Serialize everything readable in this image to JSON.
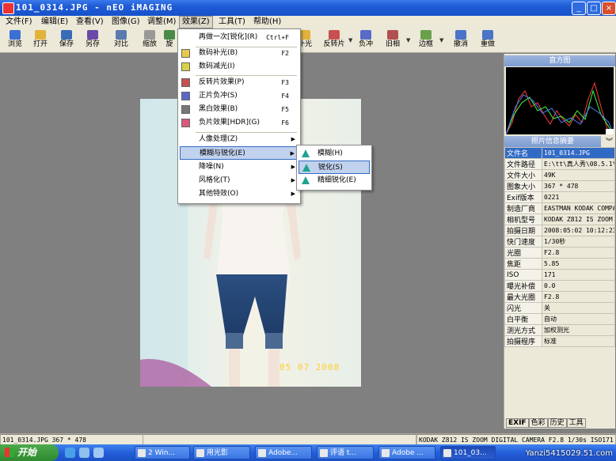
{
  "window": {
    "title": "101_0314.JPG - nEO iMAGING",
    "buttons": [
      "_",
      "□",
      "×"
    ]
  },
  "menubar": [
    {
      "label": "文件(F)"
    },
    {
      "label": "编辑(E)"
    },
    {
      "label": "查看(V)"
    },
    {
      "label": "图像(G)"
    },
    {
      "label": "调整(M)"
    },
    {
      "label": "效果(Z)"
    },
    {
      "label": "工具(T)"
    },
    {
      "label": "帮助(H)"
    }
  ],
  "toolbar": [
    {
      "label": "浏览",
      "icon": "browse-icon",
      "color": "#3b6fd4"
    },
    {
      "label": "打开",
      "icon": "open-folder-icon",
      "color": "#e2b33a"
    },
    {
      "label": "保存",
      "icon": "save-disk-icon",
      "color": "#3a6bb8"
    },
    {
      "label": "另存",
      "icon": "save-as-icon",
      "color": "#6a4aa8"
    },
    {
      "label": "对比",
      "icon": "compare-icon",
      "color": "#5a7ab0"
    },
    {
      "label": "缩放",
      "icon": "zoom-icon",
      "color": "#999999"
    },
    {
      "label": "旋",
      "icon": "rotate-icon",
      "color": "#4a8a4a"
    },
    {
      "label": "补光",
      "icon": "fill-light-icon",
      "color": "#e2b33a"
    },
    {
      "label": "反转片",
      "icon": "reversal-icon",
      "color": "#c85050"
    },
    {
      "label": "负冲",
      "icon": "cross-process-icon",
      "color": "#5a6ac8"
    },
    {
      "label": "旧相",
      "icon": "old-photo-icon",
      "color": "#b05050"
    },
    {
      "label": "边框",
      "icon": "frame-icon",
      "color": "#6aa04a"
    },
    {
      "label": "撤消",
      "icon": "undo-icon",
      "color": "#4a74c8"
    },
    {
      "label": "重做",
      "icon": "redo-icon",
      "color": "#4a74c8"
    }
  ],
  "effects_menu": {
    "items": [
      {
        "label": "再做一次[锐化](R)",
        "key": "Ctrl+F",
        "icon": "",
        "arrow": ""
      },
      {
        "label": "数码补光(B)",
        "key": "F2",
        "icon": "fill-light-icon",
        "arrow": ""
      },
      {
        "label": "数码减光(I)",
        "key": "",
        "icon": "reduce-light-icon",
        "arrow": ""
      },
      {
        "label": "反转片效果(P)",
        "key": "F3",
        "icon": "reversal-icon",
        "arrow": ""
      },
      {
        "label": "正片负冲(S)",
        "key": "F4",
        "icon": "cross-process-icon",
        "arrow": ""
      },
      {
        "label": "黑白效果(B)",
        "key": "F5",
        "icon": "bw-icon",
        "arrow": ""
      },
      {
        "label": "负片效果[HDR](G)",
        "key": "F6",
        "icon": "negative-icon",
        "arrow": ""
      },
      {
        "label": "人像处理(Z)",
        "key": "",
        "icon": "",
        "arrow": "▶"
      },
      {
        "label": "模糊与锐化(E)",
        "key": "",
        "icon": "",
        "arrow": "▶"
      },
      {
        "label": "降噪(N)",
        "key": "",
        "icon": "",
        "arrow": "▶"
      },
      {
        "label": "风格化(T)",
        "key": "",
        "icon": "",
        "arrow": "▶"
      },
      {
        "label": "其他特效(O)",
        "key": "",
        "icon": "",
        "arrow": "▶"
      }
    ],
    "highlighted": "模糊与锐化(E)"
  },
  "blur_submenu": [
    {
      "label": "模糊(H)"
    },
    {
      "label": "锐化(S)"
    },
    {
      "label": "精细锐化(E)"
    }
  ],
  "photo": {
    "date_stamp": "05 07 2008"
  },
  "right_panel": {
    "histogram_title": "直方图",
    "info_title": "照片信息摘要",
    "rows": [
      {
        "k": "文件名",
        "v": "101_0314.JPG"
      },
      {
        "k": "文件路径",
        "v": "E:\\tt\\真人秀\\08.5.1\\"
      },
      {
        "k": "文件大小",
        "v": "49K"
      },
      {
        "k": "图象大小",
        "v": "367 * 478"
      },
      {
        "k": "Exif版本",
        "v": "0221"
      },
      {
        "k": "制造厂商",
        "v": "EASTMAN KODAK COMPAN"
      },
      {
        "k": "相机型号",
        "v": "KODAK Z812 IS ZOOM D"
      },
      {
        "k": "拍摄日期",
        "v": "2008:05:02 10:12:23"
      },
      {
        "k": "快门速度",
        "v": "1/30秒"
      },
      {
        "k": "光圈",
        "v": "F2.8"
      },
      {
        "k": "焦距",
        "v": "5.85"
      },
      {
        "k": "ISO",
        "v": "171"
      },
      {
        "k": "曝光补偿",
        "v": "0.0"
      },
      {
        "k": "最大光圈",
        "v": "F2.8"
      },
      {
        "k": "闪光",
        "v": "关"
      },
      {
        "k": "白平衡",
        "v": "自动"
      },
      {
        "k": "测光方式",
        "v": "加权测光"
      },
      {
        "k": "拍摄程序",
        "v": "标准"
      }
    ],
    "tabs": [
      "EXIF",
      "色彩",
      "历史",
      "工具"
    ]
  },
  "statusbar": {
    "left": "101_0314.JPG 367 * 478",
    "right": "KODAK Z812 IS ZOOM DIGITAL CAMERA F2.8 1/30s ISO171"
  },
  "taskbar": {
    "start_label": "开始",
    "buttons": [
      "2 Win...",
      "用光影",
      "Adobe...",
      "评语 t...",
      "Adobe ...",
      "101_03..."
    ],
    "watermark": "Yanzi5415029.51.com"
  }
}
